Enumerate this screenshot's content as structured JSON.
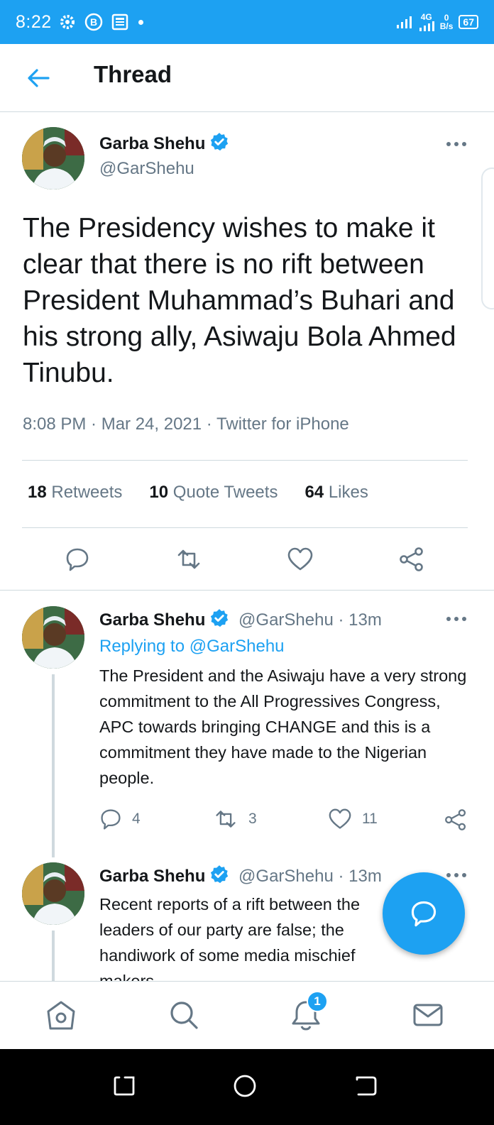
{
  "status_bar": {
    "time": "8:22",
    "network_type": "4G",
    "speed_value": "0",
    "speed_unit": "B/s",
    "battery": "67"
  },
  "header": {
    "title": "Thread"
  },
  "main_tweet": {
    "author_name": "Garba Shehu",
    "author_handle": "@GarShehu",
    "text": "The Presidency wishes to make it clear that there is no rift between President Muhammad’s Buhari and his strong ally, Asiwaju Bola Ahmed Tinubu.",
    "timestamp": "8:08 PM · Mar 24, 2021 · Twitter for iPhone",
    "retweets_count": "18",
    "retweets_label": "Retweets",
    "quote_count": "10",
    "quote_label": "Quote Tweets",
    "likes_count": "64",
    "likes_label": "Likes"
  },
  "replies": [
    {
      "author_name": "Garba Shehu",
      "author_handle": "@GarShehu · 13m",
      "replying_prefix": "Replying to ",
      "replying_to": "@GarShehu",
      "text": "The President and the Asiwaju have a very strong commitment to the All Progressives Congress, APC towards bringing CHANGE and this is a commitment they have made to the Nigerian people.",
      "reply_count": "4",
      "retweet_count": "3",
      "like_count": "11"
    },
    {
      "author_name": "Garba Shehu",
      "author_handle": "@GarShehu · 13m",
      "text": "Recent reports of a rift between the leaders of our party are false; the handiwork of some media mischief makers."
    }
  ],
  "bottom_nav": {
    "notifications_badge": "1"
  },
  "colors": {
    "accent": "#1da1f2",
    "text_primary": "#14171a",
    "text_secondary": "#657786",
    "divider": "#cfd9de"
  },
  "icons": [
    "back-arrow-icon",
    "verified-icon",
    "more-icon",
    "reply-icon",
    "retweet-icon",
    "like-icon",
    "share-icon",
    "compose-icon",
    "home-icon",
    "search-icon",
    "notifications-icon",
    "messages-icon"
  ]
}
